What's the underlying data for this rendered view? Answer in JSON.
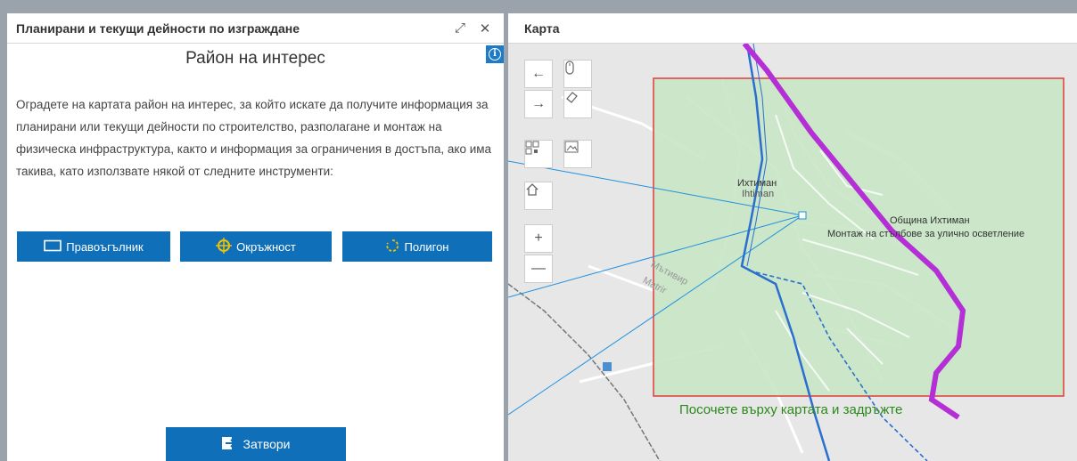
{
  "left_panel": {
    "title": "Планирани и текущи дейности по изграждане",
    "expand_icon": "⤢",
    "close_icon": "✕",
    "area_title": "Район на интерес",
    "info_icon": "i",
    "description": "Оградете на картата район на интерес, за който искате да получите информация за планирани или текущи дейности по строителство, разполагане и монтаж на физическа инфраструктура, както и информация за ограничения в достъпа, ако има такива, като използвате някой от следните инструменти:",
    "tools": [
      {
        "label": "Правоъгълник",
        "icon": "rectangle-icon"
      },
      {
        "label": "Окръжност",
        "icon": "circle-target-icon"
      },
      {
        "label": "Полигон",
        "icon": "polygon-icon"
      }
    ],
    "close_button": "Затвори"
  },
  "map_panel": {
    "title": "Карта",
    "labels": {
      "city_bg": "Ихтиман",
      "city_latin": "Ihtiman",
      "municipality": "Община Ихтиман",
      "activity": "Монтаж на стълбове за улично осветление",
      "river_bg": "Мътивир",
      "river_latin": "Matrir"
    },
    "hint": "Посочете върху картата и задръжте",
    "nav": {
      "back": "←",
      "forward": "→",
      "zoom_in": "+",
      "zoom_out": "—"
    }
  },
  "colors": {
    "accent": "#0f6fb8",
    "selection_fill": "#c8e6c4",
    "selection_border": "#e23b3b",
    "route_purple": "#b430d6",
    "route_blue": "#2a6fd0",
    "hint_green": "#2a8a1a"
  }
}
